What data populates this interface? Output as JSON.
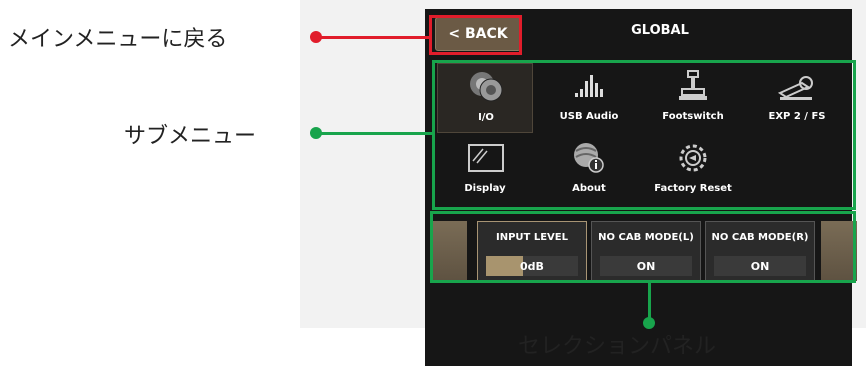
{
  "header": {
    "back_label": "< BACK",
    "title": "GLOBAL"
  },
  "submenu": {
    "items": [
      {
        "label": "I/O",
        "icon": "io-icon",
        "selected": true
      },
      {
        "label": "USB Audio",
        "icon": "usb-audio-icon",
        "selected": false
      },
      {
        "label": "Footswitch",
        "icon": "footswitch-icon",
        "selected": false
      },
      {
        "label": "EXP 2 / FS",
        "icon": "exp-pedal-icon",
        "selected": false
      },
      {
        "label": "Display",
        "icon": "display-icon",
        "selected": false
      },
      {
        "label": "About",
        "icon": "about-icon",
        "selected": false
      },
      {
        "label": "Factory Reset",
        "icon": "factory-reset-icon",
        "selected": false
      }
    ]
  },
  "selection_panel": {
    "params": [
      {
        "name": "INPUT LEVEL",
        "value": "0dB"
      },
      {
        "name": "NO CAB MODE(L)",
        "value": "ON"
      },
      {
        "name": "NO CAB MODE(R)",
        "value": "ON"
      }
    ]
  },
  "annotations": {
    "back_to_main": "メインメニューに戻る",
    "submenu": "サブメニュー",
    "selection_panel": "セレクションパネル"
  },
  "colors": {
    "annotation_green": "#18a44c",
    "annotation_red": "#e11d2b",
    "accent_tan": "#a8946e"
  }
}
